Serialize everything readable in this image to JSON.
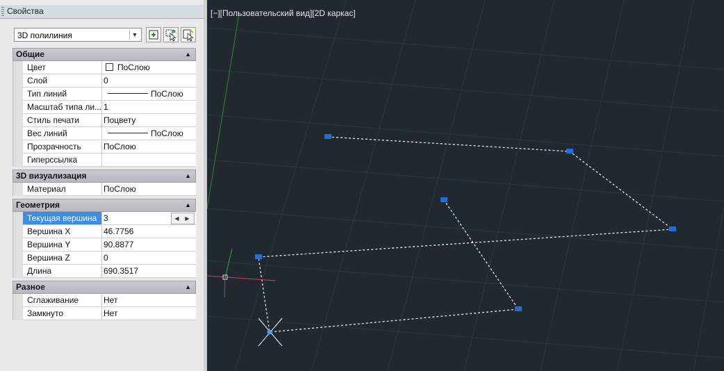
{
  "panel": {
    "title": "Свойства"
  },
  "object_select": {
    "value": "3D полилиния"
  },
  "toolbar": {
    "buttons": [
      "toggle-pickadd-icon",
      "select-objects-icon",
      "quick-select-icon"
    ]
  },
  "sections": {
    "general": {
      "title": "Общие",
      "rows": [
        {
          "label": "Цвет",
          "value": "ПоСлою"
        },
        {
          "label": "Слой",
          "value": "0"
        },
        {
          "label": "Тип линий",
          "value": "ПоСлою"
        },
        {
          "label": "Масштаб типа ли...",
          "value": "1"
        },
        {
          "label": "Стиль печати",
          "value": "Поцвету"
        },
        {
          "label": "Вес линий",
          "value": "ПоСлою"
        },
        {
          "label": "Прозрачность",
          "value": "ПоСлою"
        },
        {
          "label": "Гиперссылка",
          "value": ""
        }
      ]
    },
    "viz3d": {
      "title": "3D визуализация",
      "rows": [
        {
          "label": "Материал",
          "value": "ПоСлою"
        }
      ]
    },
    "geometry": {
      "title": "Геометрия",
      "rows": [
        {
          "label": "Текущая вершина",
          "value": "3"
        },
        {
          "label": "Вершина X",
          "value": "46.7756"
        },
        {
          "label": "Вершина Y",
          "value": "90.8877"
        },
        {
          "label": "Вершина Z",
          "value": "0"
        },
        {
          "label": "Длина",
          "value": "690.3517"
        }
      ]
    },
    "misc": {
      "title": "Разное",
      "rows": [
        {
          "label": "Сглаживание",
          "value": "Нет"
        },
        {
          "label": "Замкнуто",
          "value": "Нет"
        }
      ]
    }
  },
  "viewport": {
    "label": "[−][Пользовательский вид][2D каркас]"
  },
  "colors": {
    "selection": "#3a8ee6",
    "grip": "#1f6fd6",
    "canvas": "#212830"
  }
}
